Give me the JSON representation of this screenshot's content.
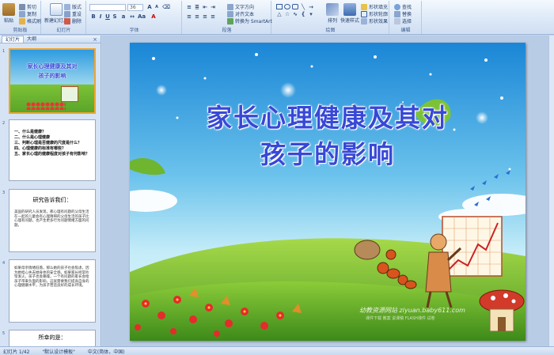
{
  "ribbon": {
    "clipboard": {
      "label": "剪贴板",
      "paste": "粘贴",
      "cut": "剪切",
      "copy": "复制",
      "format_painter": "格式刷"
    },
    "slides": {
      "label": "幻灯片",
      "new_slide": "新建幻灯片",
      "layout": "版式",
      "reset": "重设",
      "delete": "删除"
    },
    "font": {
      "label": "字体",
      "font_name": "",
      "font_size": "36"
    },
    "paragraph": {
      "label": "段落",
      "text_direction": "文字方向",
      "align_text": "对齐文本",
      "smartart": "转换为 SmartArt"
    },
    "drawing": {
      "label": "绘图",
      "arrange": "排列",
      "quick_styles": "快速样式",
      "shape_fill": "形状填充",
      "shape_outline": "形状轮廓",
      "shape_effects": "形状效果"
    },
    "editing": {
      "label": "编辑",
      "find": "查找",
      "replace": "替换",
      "select": "选择"
    }
  },
  "panel": {
    "tab_slides": "幻灯片",
    "tab_outline": "大纲",
    "close": "×"
  },
  "thumbnails": [
    {
      "num": "1",
      "line1": "家长心理健康及其对",
      "line2": "孩子的影响"
    },
    {
      "num": "2",
      "items": [
        "一、什么是健康？",
        "二、什么是心理健康",
        "三、判断心理是否健康的尺度是什么？",
        "四、心理健康的标准有哪些？",
        "五、家长心理的健康程度对孩子有何影响？"
      ]
    },
    {
      "num": "3",
      "title": "研究告诉我们：",
      "body": "美国的研究人员发现，那心理有问题的父母生活在一起的儿童会有心理障碍的父母生活的孩子比心理有问题，也产生更多行为问题情绪方面的问题。"
    },
    {
      "num": "4",
      "body": "如果母亲情绪低落，那么她的孩子也会焦虑，因为她担心失去她身体的安全感。如果家长经常吵架发火，孩子也会暴躁，一个有问题的家长会给孩子带来负面的影响，这就需要我们提高自身的心理健康水平，为孩子营造良好的成长环境。"
    },
    {
      "num": "5",
      "title": "所幸的是："
    }
  ],
  "slide": {
    "title_line1": "家长心理健康及其对",
    "title_line2": "孩子的影响",
    "watermark": "幼教资源网站 ziyuan.baby611.com",
    "watermark_sub": "课件下载  教案  说课稿  FLASH课件  试卷"
  },
  "status": {
    "slide_pos": "幻灯片 1/42",
    "theme": "\"默认设计模板\"",
    "lang": "中文(简体，中国)"
  },
  "colors": {
    "title": "#3848d6",
    "accent": "#f3a32c",
    "sky_top": "#1d8fd9",
    "sky_mid": "#8fd3ee",
    "grass": "#7cc236"
  }
}
